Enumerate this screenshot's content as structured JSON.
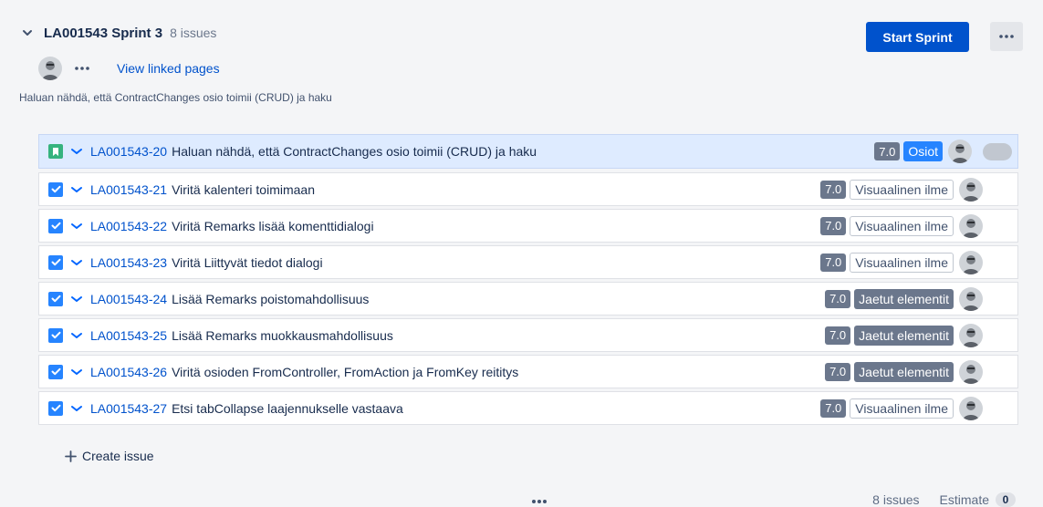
{
  "sprint": {
    "name": "LA001543 Sprint 3",
    "issue_count": "8 issues",
    "start_label": "Start Sprint",
    "linked_pages_label": "View linked pages",
    "goal": "Haluan nähdä, että ContractChanges osio toimii (CRUD) ja haku"
  },
  "issues": [
    {
      "key": "LA001543-20",
      "summary": "Haluan nähdä, että ContractChanges osio toimii (CRUD) ja haku",
      "points": "7.0",
      "label": "Osiot",
      "type": "story-icon",
      "selected": true
    },
    {
      "key": "LA001543-21",
      "summary": "Viritä kalenteri toimimaan",
      "points": "7.0",
      "label": "Visuaalinen ilme",
      "type": "checkbox-icon"
    },
    {
      "key": "LA001543-22",
      "summary": "Viritä Remarks lisää komenttidialogi",
      "points": "7.0",
      "label": "Visuaalinen ilme",
      "type": "checkbox-icon"
    },
    {
      "key": "LA001543-23",
      "summary": "Viritä Liittyvät tiedot dialogi",
      "points": "7.0",
      "label": "Visuaalinen ilme",
      "type": "checkbox-icon"
    },
    {
      "key": "LA001543-24",
      "summary": "Lisää Remarks poistomahdollisuus",
      "points": "7.0",
      "label": "Jaetut elementit",
      "type": "checkbox-icon"
    },
    {
      "key": "LA001543-25",
      "summary": "Lisää Remarks muokkausmahdollisuus",
      "points": "7.0",
      "label": "Jaetut elementit",
      "type": "checkbox-icon"
    },
    {
      "key": "LA001543-26",
      "summary": "Viritä osioden FromController, FromAction ja FromKey reititys",
      "points": "7.0",
      "label": "Jaetut elementit",
      "type": "checkbox-icon"
    },
    {
      "key": "LA001543-27",
      "summary": "Etsi tabCollapse laajennukselle vastaava",
      "points": "7.0",
      "label": "Visuaalinen ilme",
      "type": "checkbox-icon"
    }
  ],
  "create_issue_label": "Create issue",
  "footer": {
    "issues": "8 issues",
    "estimate_label": "Estimate",
    "estimate_value": "0"
  },
  "colors": {
    "primary": "#0052cc",
    "story": "#36b37e",
    "task": "#2684ff",
    "badge": "#6b778c"
  }
}
